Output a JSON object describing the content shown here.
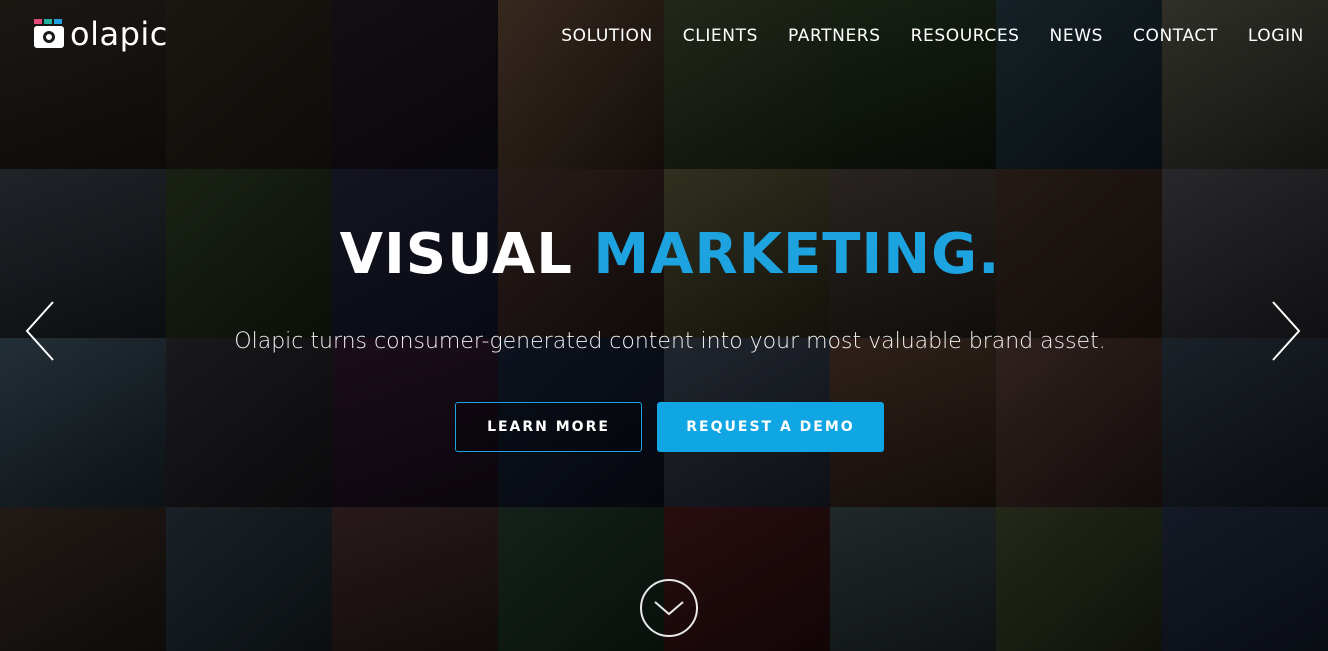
{
  "brand": {
    "name": "olapic",
    "logo_colors": [
      "#e64a7a",
      "#22b3a0",
      "#1ca3e0"
    ],
    "accent": "#1ca3e0"
  },
  "nav": {
    "items": [
      {
        "label": "SOLUTION"
      },
      {
        "label": "CLIENTS"
      },
      {
        "label": "PARTNERS"
      },
      {
        "label": "RESOURCES"
      },
      {
        "label": "NEWS"
      },
      {
        "label": "CONTACT"
      },
      {
        "label": "LOGIN"
      }
    ]
  },
  "hero": {
    "headline_white": "VISUAL",
    "headline_accent": "MARKETING.",
    "subheadline": "Olapic turns consumer-generated content into your most valuable brand asset.",
    "primary_cta": "LEARN MORE",
    "secondary_cta": "REQUEST A DEMO"
  },
  "carousel": {
    "prev_icon": "chevron-left-icon",
    "next_icon": "chevron-right-icon"
  },
  "scroll": {
    "icon": "chevron-down-icon"
  }
}
